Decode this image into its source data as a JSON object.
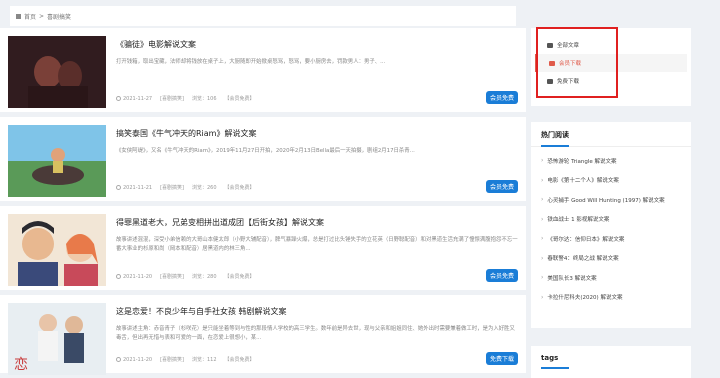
{
  "breadcrumb": {
    "home": "首页",
    "sep": ">",
    "current": "喜剧搞笑"
  },
  "posts": [
    {
      "title": "《骗徒》电影解说文案",
      "desc": "打开钱箱，取出宝藏，法师却将钱放在桌子上，大厨随即开始掀桌怒骂，怒骂，要小厨房去，罚款男人：男子、...",
      "date": "2021-11-27",
      "cat": "[喜剧搞笑]",
      "views": "浏览：106",
      "likes": "【会员免费】",
      "badge": "会员免费"
    },
    {
      "title": "搞笑泰国《牛气冲天的Riam》解说文案",
      "desc": "《女侠阿缇》，又名《牛气冲天的Riam》，2019年11月27日开拍，2020年2月13日Bella最后一天拍摄，剧组2月17日杀青...",
      "date": "2021-11-21",
      "cat": "[喜剧搞笑]",
      "views": "浏览：260",
      "likes": "【会员免费】",
      "badge": "会员免费"
    },
    {
      "title": "得罪黑道老大，兄弟变相拼出道成团【后街女孩】解说文案",
      "desc": "故事讲述混混，深受小弟信赖的大哥山本健太郎（小野大辅配音），脾气暴躁火爆，总是打过比头锤失手的立花英（日野聪配音）和对黑道生活充满了憧憬满腹抱怨不忘一番大事业的杉原和尚（岡本和配音）居黑道内的林三角...",
      "date": "2021-11-20",
      "cat": "[喜剧搞笑]",
      "views": "浏览：280",
      "likes": "【会员免费】",
      "badge": "会员免费"
    },
    {
      "title": "这是恋爱！不良少年与自手社女孩 韩剧解说文案",
      "desc": "故事讲述主角：赤音青子（杉咲花）是只能坐着等到与性的那段情人学校的高三学生。数年前是异去世，现与父亲和姐姐同住、她外出时需要兼着做工时，是为入好胜又毒舌，但出再无惜与表和可爱的一面，在恋爱上很想小，某...",
      "date": "2021-11-20",
      "cat": "[喜剧搞笑]",
      "views": "浏览：112",
      "likes": "【会员免费】",
      "badge": "免费下载"
    }
  ],
  "categories": [
    {
      "label": "全部文章",
      "active": false
    },
    {
      "label": "会员下载",
      "active": true
    },
    {
      "label": "免费下载",
      "active": false
    }
  ],
  "hot": {
    "title": "热门阅读",
    "items": [
      "恐怖游轮 Triangle 解说文案",
      "电影《第十二个人》解说文案",
      "心灵捕手 Good Will Hunting (1997) 解说文案",
      "铁血战士 1 影视解说文案",
      "《哥尔达：信仰日本》解说文案",
      "春联警4：终局之战 解说文案",
      "美国队长3 解说文案",
      "卡拉什尼科夫(2020) 解说文案"
    ]
  },
  "tags": {
    "title": "tags"
  },
  "colors": {
    "accent": "#1a7dd7",
    "active": "#e05b4b",
    "highlight_box": "#e02020"
  }
}
